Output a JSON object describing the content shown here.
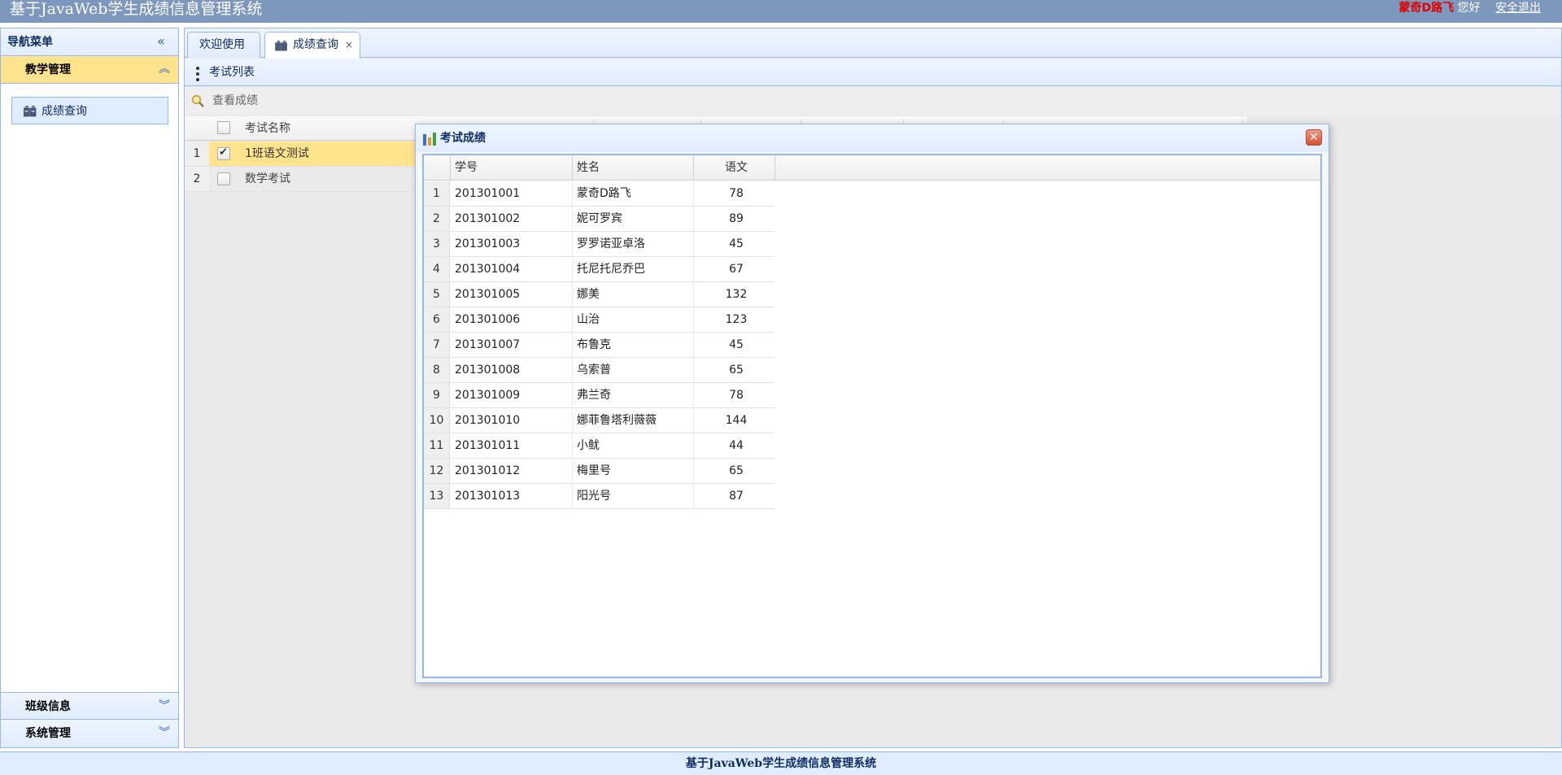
{
  "header": {
    "title": "基于JavaWeb学生成绩信息管理系统",
    "user_name": "蒙奇D路飞",
    "greeting": "您好",
    "logout": "安全退出"
  },
  "sidebar": {
    "title": "导航菜单",
    "sections": [
      {
        "label": "教学管理",
        "expanded": true,
        "items": [
          {
            "label": "成绩查询",
            "icon": "cards-icon"
          }
        ]
      },
      {
        "label": "班级信息",
        "expanded": false
      },
      {
        "label": "系统管理",
        "expanded": false
      }
    ]
  },
  "tabs": [
    {
      "label": "欢迎使用",
      "selected": false
    },
    {
      "label": "成绩查询",
      "selected": true,
      "closable": true,
      "close": "×"
    }
  ],
  "exam_list": {
    "title": "考试列表",
    "toolbar": {
      "view_scores": "查看成绩"
    },
    "column": "考试名称",
    "rows": [
      {
        "num": "1",
        "name": "1班语文测试",
        "checked": true
      },
      {
        "num": "2",
        "name": "数学考试",
        "checked": false
      }
    ]
  },
  "dialog": {
    "title": "考试成绩",
    "close": "✕",
    "columns": [
      "学号",
      "姓名",
      "语文"
    ],
    "rows": [
      {
        "n": "1",
        "id": "201301001",
        "name": "蒙奇D路飞",
        "score": "78"
      },
      {
        "n": "2",
        "id": "201301002",
        "name": "妮可罗宾",
        "score": "89"
      },
      {
        "n": "3",
        "id": "201301003",
        "name": "罗罗诺亚卓洛",
        "score": "45"
      },
      {
        "n": "4",
        "id": "201301004",
        "name": "托尼托尼乔巴",
        "score": "67"
      },
      {
        "n": "5",
        "id": "201301005",
        "name": "娜美",
        "score": "132"
      },
      {
        "n": "6",
        "id": "201301006",
        "name": "山治",
        "score": "123"
      },
      {
        "n": "7",
        "id": "201301007",
        "name": "布鲁克",
        "score": "45"
      },
      {
        "n": "8",
        "id": "201301008",
        "name": "乌索普",
        "score": "65"
      },
      {
        "n": "9",
        "id": "201301009",
        "name": "弗兰奇",
        "score": "78"
      },
      {
        "n": "10",
        "id": "201301010",
        "name": "娜菲鲁塔利薇薇",
        "score": "144"
      },
      {
        "n": "11",
        "id": "201301011",
        "name": "小鱿",
        "score": "44"
      },
      {
        "n": "12",
        "id": "201301012",
        "name": "梅里号",
        "score": "65"
      },
      {
        "n": "13",
        "id": "201301013",
        "name": "阳光号",
        "score": "87"
      }
    ]
  },
  "footer": {
    "text": "基于JavaWeb学生成绩信息管理系统"
  },
  "colors": {
    "header_bg": "#7d97bd",
    "panel_border": "#95b8e7",
    "selected_row": "#ffe48d",
    "user_name": "#e00000"
  }
}
